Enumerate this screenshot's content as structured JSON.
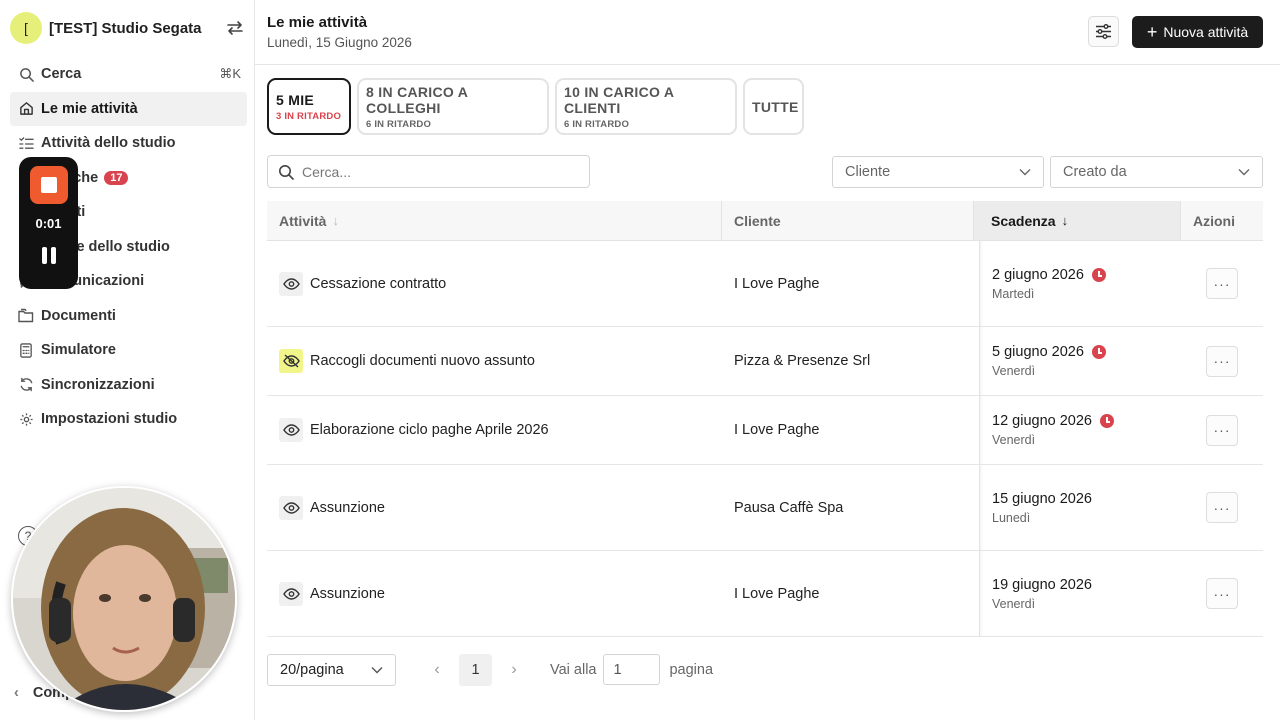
{
  "sidebar": {
    "studio_initial": "[",
    "studio_name": "[TEST] Studio Segata",
    "search_label": "Cerca",
    "search_shortcut": "⌘K",
    "items": [
      {
        "label": "Le mie attività",
        "icon": "home-icon"
      },
      {
        "label": "Attività dello studio",
        "icon": "checklist-icon"
      },
      {
        "label": "Pratiche",
        "icon": "folder-icon",
        "badge": "17"
      },
      {
        "label": "Clienti",
        "icon": "users-icon"
      },
      {
        "label": "Paghe dello studio",
        "icon": "wallet-icon"
      },
      {
        "label": "Comunicazioni",
        "icon": "chat-icon"
      },
      {
        "label": "Documenti",
        "icon": "documents-icon"
      },
      {
        "label": "Simulatore",
        "icon": "calculator-icon"
      },
      {
        "label": "Sincronizzazioni",
        "icon": "sync-icon"
      },
      {
        "label": "Impostazioni studio",
        "icon": "gear-icon"
      }
    ],
    "collapse_label": "Comprimi"
  },
  "recorder": {
    "time": "0:01"
  },
  "header": {
    "title": "Le mie attività",
    "date": "Lunedì, 15 Giugno 2026",
    "new_button": "Nuova attività"
  },
  "tabs": [
    {
      "title": "5 MIE",
      "subtitle": "3 IN RITARDO"
    },
    {
      "title": "8 IN CARICO A COLLEGHI",
      "subtitle": "6 IN RITARDO"
    },
    {
      "title": "10 IN CARICO A CLIENTI",
      "subtitle": "6 IN RITARDO"
    },
    {
      "title": "TUTTE",
      "subtitle": ""
    }
  ],
  "filters": {
    "search_placeholder": "Cerca...",
    "client_placeholder": "Cliente",
    "created_by_placeholder": "Creato da"
  },
  "table": {
    "columns": [
      "Attività",
      "Cliente",
      "Scadenza",
      "Azioni"
    ],
    "rows": [
      {
        "activity": "Cessazione contratto",
        "client": "I Love Paghe",
        "due": "2 giugno 2026",
        "weekday": "Martedì",
        "late": true,
        "visible": true
      },
      {
        "activity": "Raccogli documenti nuovo assunto",
        "client": "Pizza & Presenze Srl",
        "due": "5 giugno 2026",
        "weekday": "Venerdì",
        "late": true,
        "visible": false
      },
      {
        "activity": "Elaborazione ciclo paghe Aprile 2026",
        "client": "I Love Paghe",
        "due": "12 giugno 2026",
        "weekday": "Venerdì",
        "late": true,
        "visible": true
      },
      {
        "activity": "Assunzione",
        "client": "Pausa Caffè Spa",
        "due": "15 giugno 2026",
        "weekday": "Lunedì",
        "late": false,
        "visible": true
      },
      {
        "activity": "Assunzione",
        "client": "I Love Paghe",
        "due": "19 giugno 2026",
        "weekday": "Venerdì",
        "late": false,
        "visible": true
      }
    ],
    "more_label": "···"
  },
  "pagination": {
    "per_page": "20/pagina",
    "current_page": "1",
    "goto_label": "Vai alla",
    "goto_value": "1",
    "page_label": "pagina"
  },
  "colors": {
    "accent_dark": "#1c1c1c",
    "late_red": "#d9434e",
    "recorder_orange": "#ef5a2e",
    "avatar_yellow": "#e6ef7a"
  }
}
